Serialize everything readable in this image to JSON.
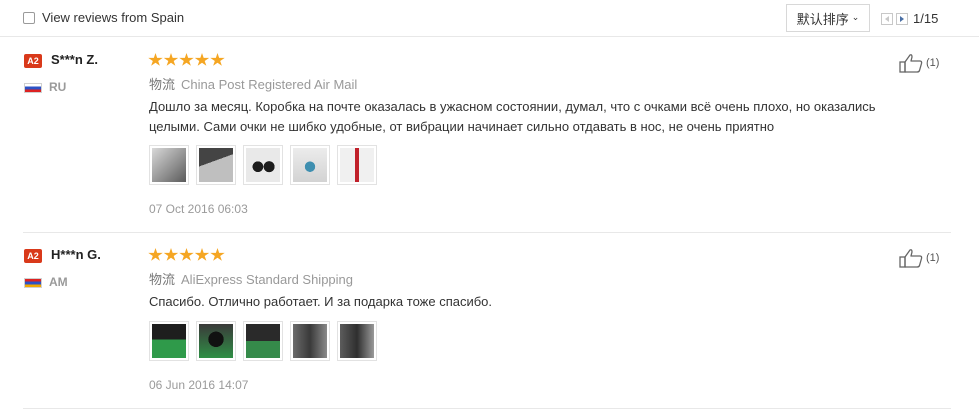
{
  "toolbar": {
    "filter_label": "View reviews from Spain",
    "filter_checked": false,
    "sort_label": "默认排序",
    "page_indicator": "1/15"
  },
  "reviews": [
    {
      "badge": "A2",
      "name": "S***n Z.",
      "country": "RU",
      "rating": 5,
      "shipping_label": "物流",
      "shipping_method": "China Post Registered Air Mail",
      "text": "Дошло за месяц. Коробка на почте оказалась в ужасном состоянии, думал, что с очками всё очень плохо, но оказались целыми. Сами очки не шибко удобные, от вибрации начинает сильно отдавать в нос, не очень приятно",
      "date": "07 Oct 2016 06:03",
      "likes": "(1)",
      "photo_count": 5
    },
    {
      "badge": "A2",
      "name": "H***n G.",
      "country": "AM",
      "rating": 5,
      "shipping_label": "物流",
      "shipping_method": "AliExpress Standard Shipping",
      "text": "Спасибо. Отлично работает. И за подарка тоже спасибо.",
      "date": "06 Jun 2016 14:07",
      "likes": "(1)",
      "photo_count": 5
    }
  ],
  "colors": {
    "badge": "#d9391a",
    "star": "#f5a623",
    "muted_text": "#9a9a9a",
    "border": "#e8e8e8"
  }
}
